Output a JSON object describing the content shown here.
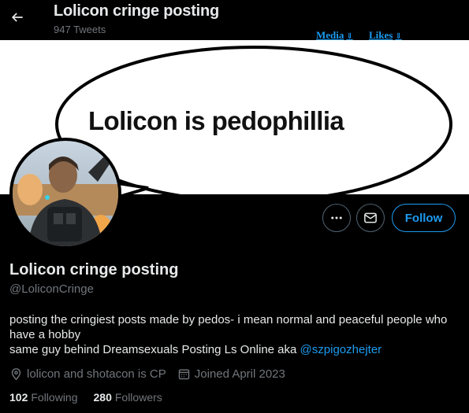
{
  "header": {
    "title": "Lolicon cringe posting",
    "tweet_count": "947 Tweets",
    "back_icon": "arrow-left-icon"
  },
  "tabs": {
    "media": "Media",
    "likes": "Likes",
    "arrow": "⇓"
  },
  "banner": {
    "text": "Lolicon is pedophillia"
  },
  "actions": {
    "more_icon": "more-dots-icon",
    "message_icon": "envelope-icon",
    "follow_label": "Follow"
  },
  "profile": {
    "display_name": "Lolicon cringe posting",
    "handle": "@LoliconCringe",
    "bio_lines": [
      "posting the cringiest posts made by pedos- i mean normal and peaceful people who have a hobby",
      "same guy behind Dreamsexuals Posting Ls Online aka "
    ],
    "bio_mention": "@szpigozhejter",
    "location": "lolicon and shotacon is CP",
    "joined": "Joined April 2023",
    "following_count": "102",
    "following_label": "Following",
    "followers_count": "280",
    "followers_label": "Followers"
  },
  "colors": {
    "background": "#000000",
    "accent": "#1d9bf0",
    "text_primary": "#e7e9ea",
    "text_secondary": "#71767b",
    "border": "#536471"
  }
}
